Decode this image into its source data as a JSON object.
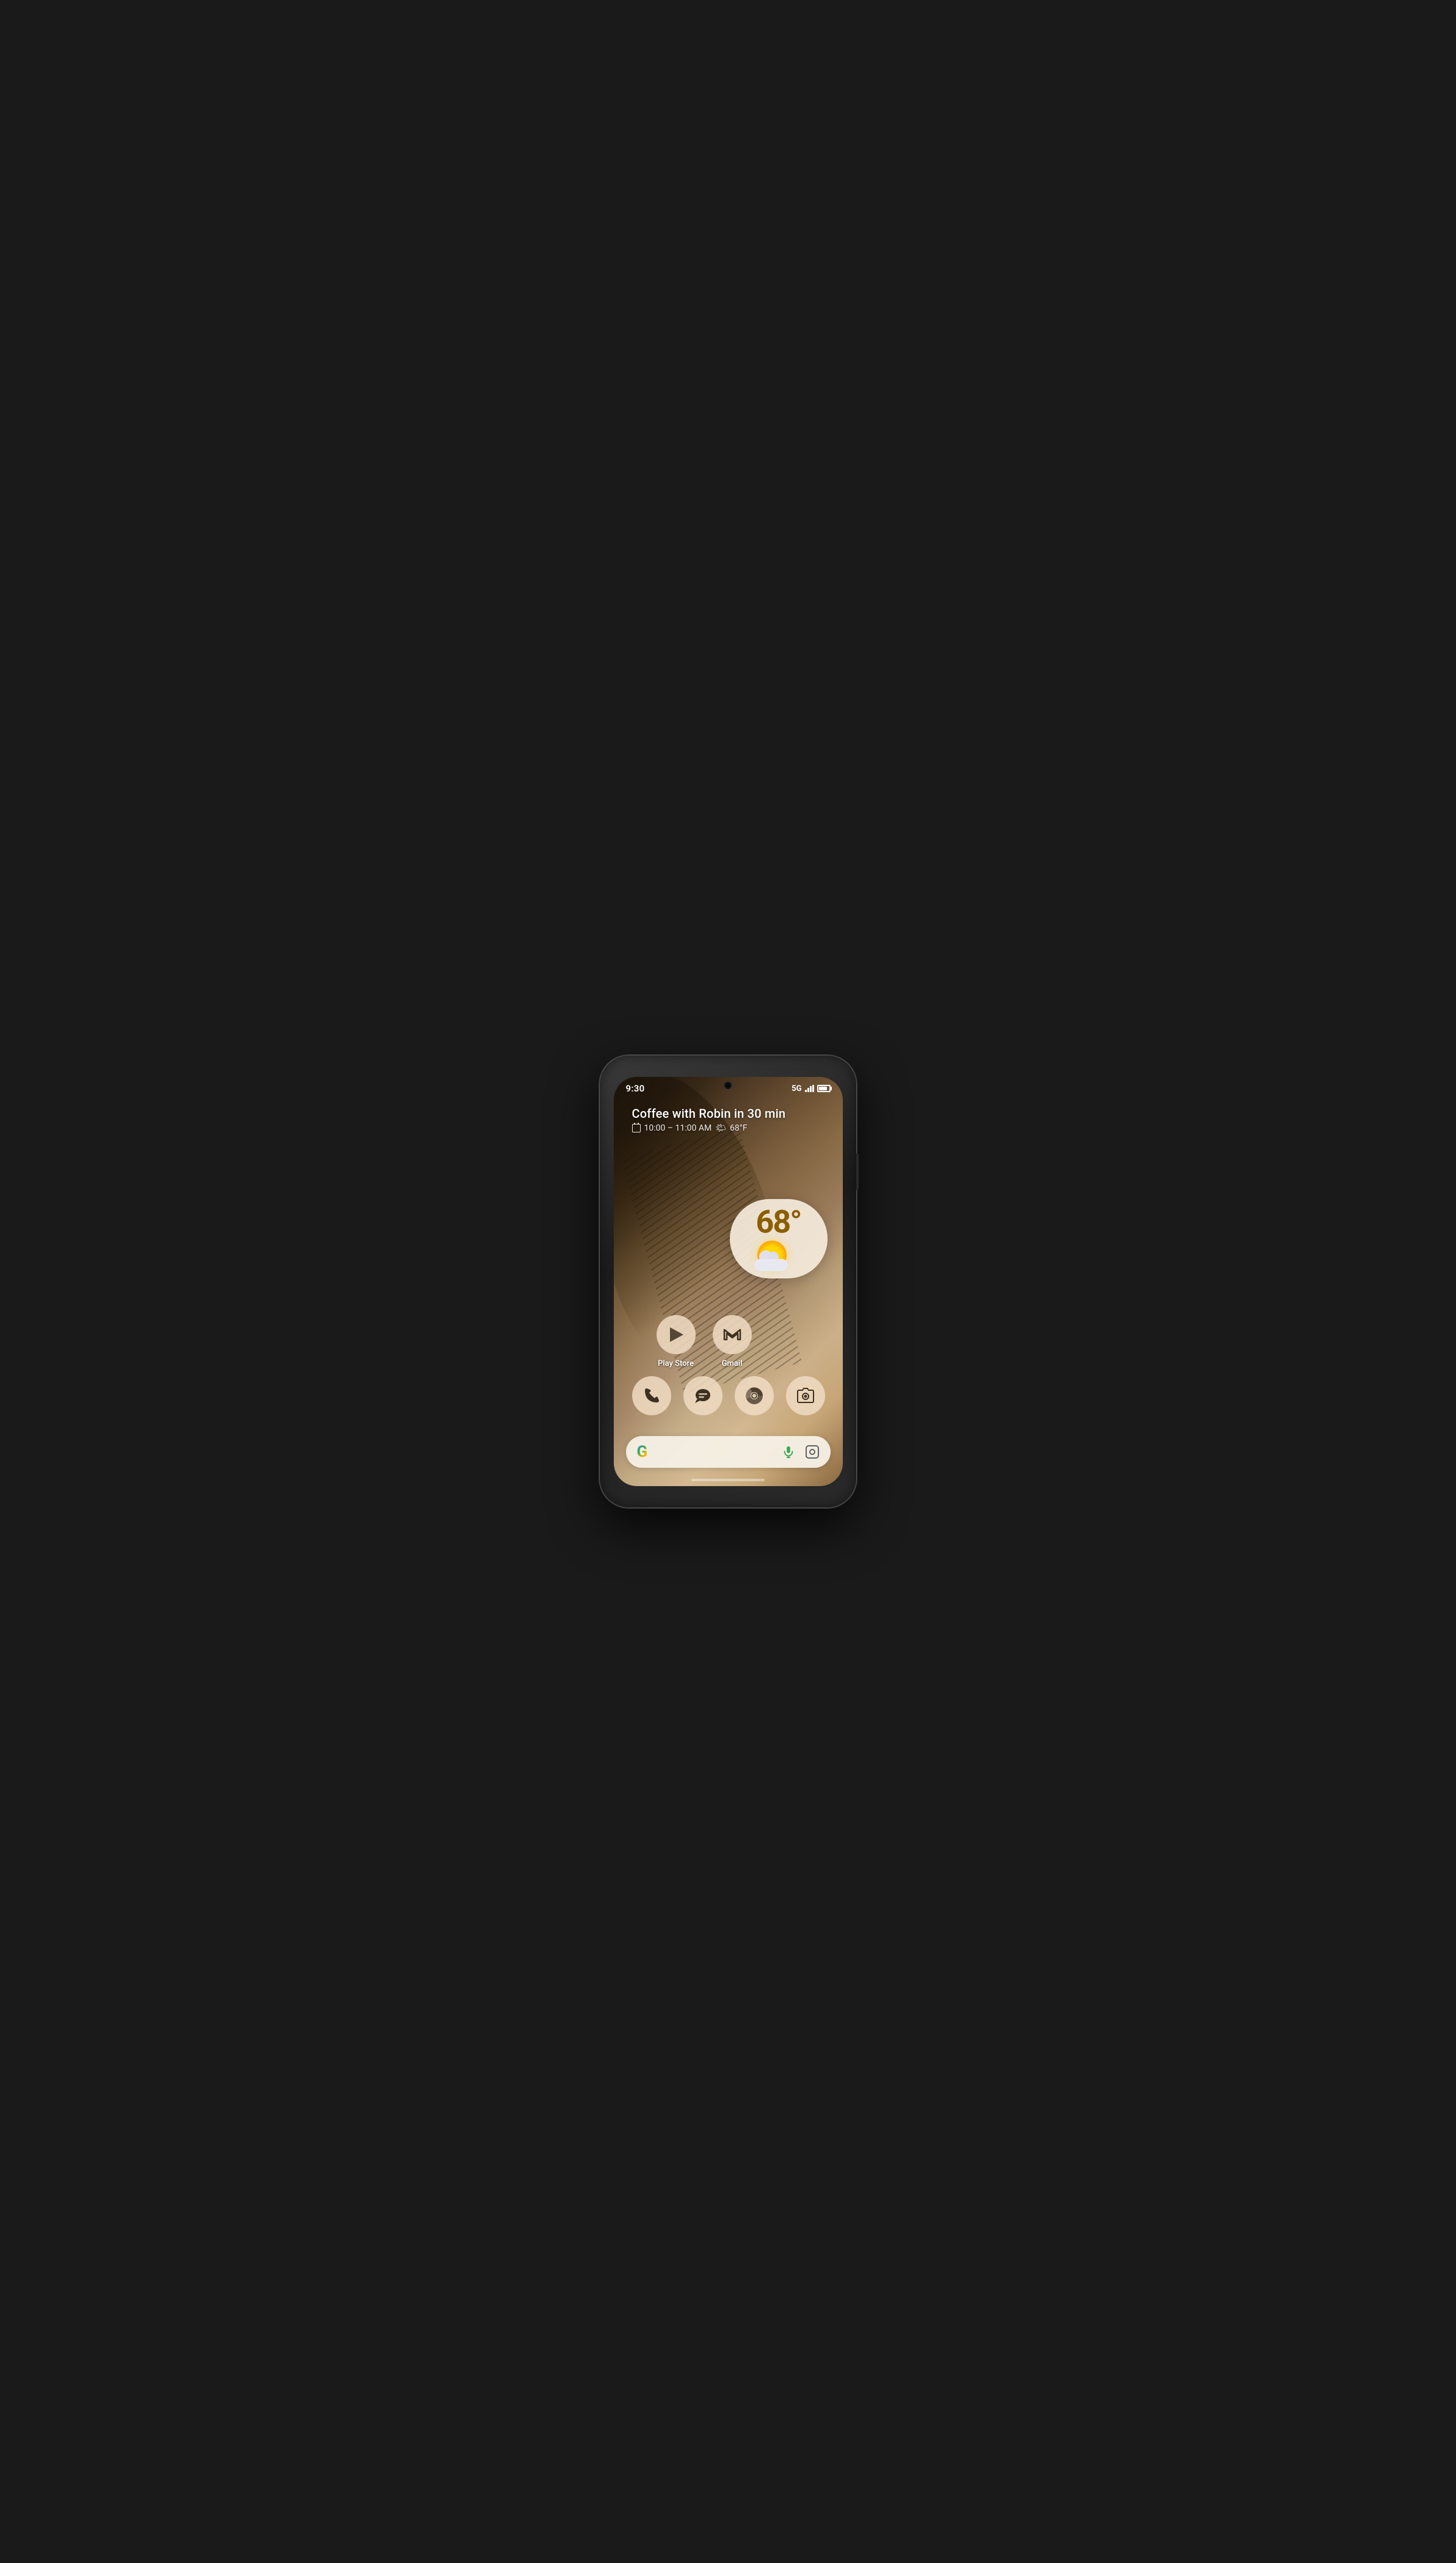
{
  "phone": {
    "status_bar": {
      "time": "9:30",
      "network": "5G"
    },
    "event": {
      "title": "Coffee with Robin in 30 min",
      "time_range": "10:00 – 11:00 AM",
      "temperature": "68°F"
    },
    "weather": {
      "temp": "68°",
      "condition": "partly cloudy"
    },
    "apps_row1": [
      {
        "id": "play-store",
        "label": "Play Store"
      },
      {
        "id": "gmail",
        "label": "Gmail"
      }
    ],
    "apps_row2": [
      {
        "id": "phone",
        "label": ""
      },
      {
        "id": "messages",
        "label": ""
      },
      {
        "id": "chrome",
        "label": ""
      },
      {
        "id": "camera",
        "label": ""
      }
    ],
    "search_bar": {
      "google_letter": "G",
      "mic_label": "microphone",
      "lens_label": "lens"
    }
  }
}
